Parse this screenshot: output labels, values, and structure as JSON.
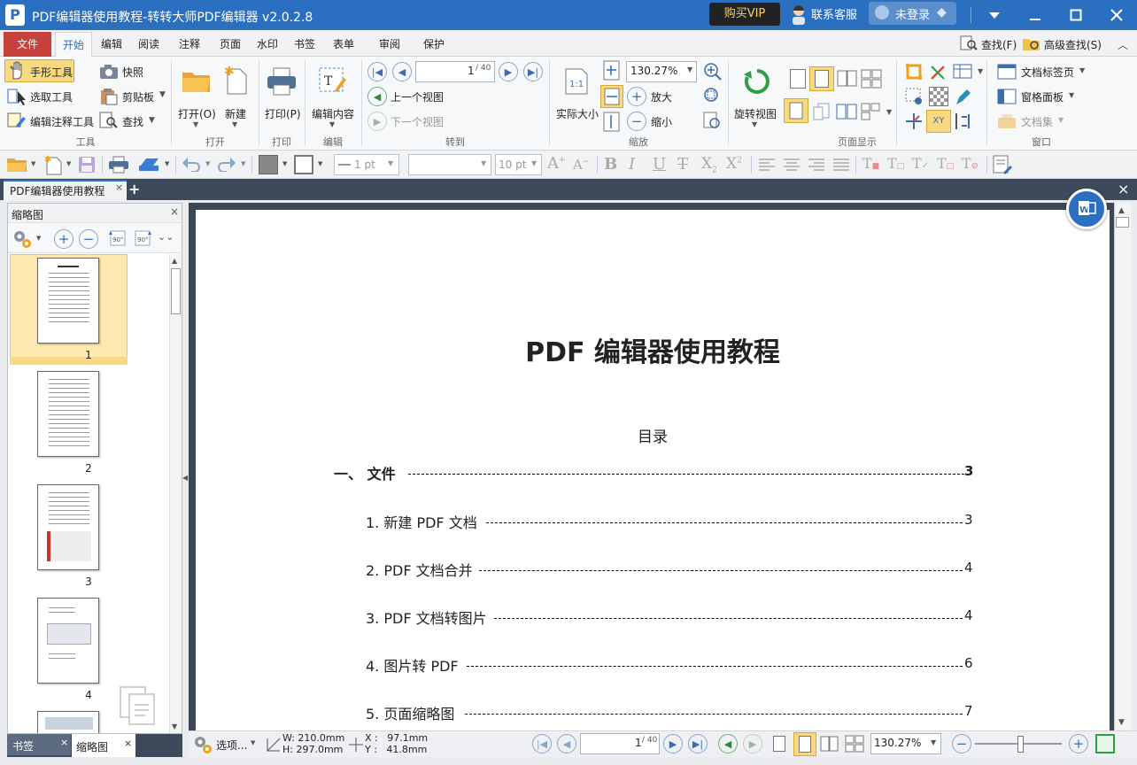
{
  "window": {
    "title": "PDF编辑器使用教程-转转大师PDF编辑器 v2.0.2.8",
    "buy_vip": "购买VIP",
    "support": "联系客服",
    "login": "未登录"
  },
  "menu": [
    "文件",
    "开始",
    "编辑",
    "阅读",
    "注释",
    "页面",
    "水印",
    "书签",
    "表单",
    "审阅",
    "保护"
  ],
  "menu_right": {
    "find": "查找(F)",
    "advanced_find": "高级查找(S)"
  },
  "ribbon": {
    "tools": {
      "hand": "手形工具",
      "select": "选取工具",
      "edit_annot": "编辑注释工具",
      "snapshot": "快照",
      "clipboard": "剪贴板",
      "find": "查找",
      "group": "工具"
    },
    "open": {
      "open": "打开(O)",
      "new": "新建",
      "group": "打开"
    },
    "print": {
      "print": "打印(P)",
      "group": "打印"
    },
    "edit": {
      "edit_content": "编辑内容",
      "group": "编辑"
    },
    "goto": {
      "page": "1",
      "total": "/ 40",
      "prev_view": "上一个视图",
      "next_view": "下一个视图",
      "group": "转到"
    },
    "zoom": {
      "actual": "实际大小",
      "value": "130.27%",
      "zoom_in": "放大",
      "zoom_out": "缩小",
      "group": "缩放"
    },
    "page_display": {
      "rotate": "旋转视图",
      "group": "页面显示"
    },
    "window": {
      "doc_tabs": "文档标签页",
      "panes": "窗格面板",
      "doc_set": "文档集",
      "group": "窗口"
    }
  },
  "toolbar2": {
    "line_width": "1 pt",
    "font": "",
    "font_size": "10 pt"
  },
  "doc_tab": "PDF编辑器使用教程",
  "thumb_panel": {
    "title": "缩略图",
    "pages": [
      "1",
      "2",
      "3",
      "4"
    ]
  },
  "bottom_tabs": {
    "bookmarks": "书签",
    "thumbnails": "缩略图"
  },
  "document": {
    "title": "PDF 编辑器使用教程",
    "toc_heading": "目录",
    "toc": [
      {
        "label": "一、  文件",
        "page": "3"
      },
      {
        "label": "1.  新建 PDF 文档",
        "page": "3"
      },
      {
        "label": "2. PDF 文档合并",
        "page": "4"
      },
      {
        "label": "3. PDF 文档转图片",
        "page": "4"
      },
      {
        "label": "4.  图片转 PDF",
        "page": "6"
      },
      {
        "label": "5.  页面缩略图",
        "page": "7"
      }
    ]
  },
  "status": {
    "options": "选项...",
    "w": "W: 210.0mm",
    "h": "H: 297.0mm",
    "x": "X :   97.1mm",
    "y": "Y :   41.8mm",
    "page": "1",
    "total": "/ 40",
    "zoom": "130.27%"
  },
  "colors": {
    "titlebar": "#2a6fc0",
    "accent": "#2a6fc0",
    "file_menu": "#c8413a",
    "highlight": "#f9d97f"
  }
}
